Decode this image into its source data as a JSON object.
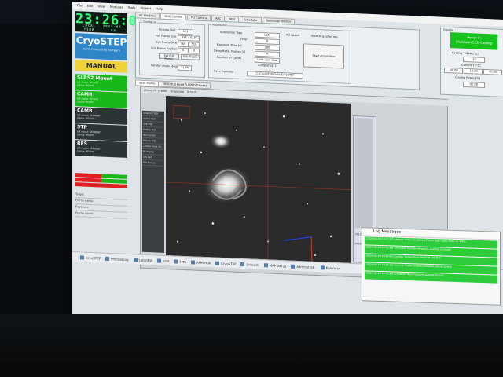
{
  "menubar": [
    "File",
    "Edit",
    "View",
    "Modules",
    "Tools",
    "Project",
    "Help"
  ],
  "clock": {
    "time": "23:26:06",
    "date_left": "LOCAL TIME",
    "date_right": "2024-04-08"
  },
  "logo": {
    "title": "CryoSTEP",
    "subtitle": "AUTO Powered by Software"
  },
  "mode": "MANUAL mode",
  "status_items": [
    {
      "name": "SLRS7 Mount",
      "line1": "set mode: ACTIVE",
      "line2": "status: READY",
      "style": "green"
    },
    {
      "name": "CAMR",
      "line1": "set mode: ACTIVE",
      "line2": "status: READY",
      "style": "green"
    },
    {
      "name": "CAMB",
      "line1": "set mode: STANDBY",
      "line2": "status: READY",
      "style": "dark"
    },
    {
      "name": "STP",
      "line1": "set mode: STANDBY",
      "line2": "status: READY",
      "style": "dark"
    },
    {
      "name": "RFS",
      "line1": "set mode: STANDBY",
      "line2": "status: READY",
      "style": "dark"
    }
  ],
  "mini_rows": [
    "Target",
    "Frame name:",
    "Exposure:",
    "Frame count:"
  ],
  "top_tabs": [
    "All Windows",
    "SBIG Camera",
    "FLI Camera",
    "APC",
    "Mail",
    "Scheduler",
    "Telescope Monitor"
  ],
  "config": {
    "title": "Configure",
    "binning_label": "Binning [px]",
    "binning_value": "1x1",
    "full_frame_label": "Full Frame Size",
    "full_frame_value": "765 x 510",
    "sub_frame_size_label": "Sub Frame Size",
    "sub_frame_w": "765",
    "sub_frame_h": "510",
    "sub_frame_pos_label": "Sub Frame Position",
    "sub_x": "0",
    "sub_y": "0",
    "full_frame_btn": "Set Full Frame",
    "subframe_btn": "Sub Frame",
    "rotator_label": "Rotator angle (deg)",
    "rotator_value": "11.66"
  },
  "acquisition": {
    "title": "Acquisition",
    "type_label": "Acquisition Type",
    "type_value": "Light",
    "filter_label": "Filter",
    "filter_value": "G",
    "exposure_label": "Exposure Time [s]",
    "exposure_value": "180",
    "delay_label": "Delay Betw. Frames [s]",
    "delay_value": "0",
    "cycles_label": "Number of Cycles",
    "cycles_value": "Until user stop",
    "completed": "Completed: 1",
    "save_fits_label": "Save Frame(s)",
    "path_value": "C:\\CryoSTEP\\Data\\CryoSTEP",
    "chk1": "AO speed",
    "chk2": "Start Acq. after rep.",
    "start_btn": "Start Acquisition"
  },
  "cooling": {
    "title": "Cooling",
    "power_btn_line1": "Power in",
    "power_btn_line2": "Shutdown CCD Cooling",
    "goal_label": "Cooling T Goal [°C]",
    "goal_value": "-10",
    "current_label": "Current T [°C]",
    "current_values": [
      "-40.00",
      "-10.20",
      "40.00"
    ],
    "power_label": "Cooling Power [%]",
    "power_value": "65.00"
  },
  "image_tabs": [
    "SBIG Frame",
    "MODBUS Read FLI-PRO Camera"
  ],
  "image_toolbar": [
    "Zoom: Fit Screen",
    "Grayscale",
    "Stretch"
  ],
  "side_panel": [
    "Selected ROI",
    "Action ROI",
    "Sub ROI",
    "Modify ROI",
    "ROI Center",
    "Delete ROI",
    "Center View On",
    "Fit Frame",
    "Sky Ref",
    "Full Frame"
  ],
  "right_col": {
    "label1": "20131.0",
    "label2": "6555.0"
  },
  "status_line": "Position: 440.17, 205.71  Pix. value: 2467.0  Dec: 05h36m00.10s  RA: 09h33m02.21s",
  "taskbar": [
    "CryoSTEP",
    "ProcessLog",
    "LabVIEW",
    "SCH",
    "FITS",
    "AMR Hub",
    "CryoSTEP",
    "Unleash",
    "MAP (MTZ)",
    "Adminstrati.",
    "Kalendar",
    "Kamera",
    "Kommunikace",
    "WebServer",
    "CryoSTEP"
  ],
  "log": {
    "title": "Log Messages",
    "rows": [
      "[2024-04-08 23:21:15] Camera: Exposure started, Frame type: Light, Filter: G, 180 s",
      "[2024-04-08 23:22:40] Telescope: Position refreshed, tracking on target",
      "[2024-04-08 23:24:00] Cooling: Temperature stable at -10.20 C",
      "[2024-04-08 23:24:15] Camera: Frame readout complete, saving to disk",
      "[2024-04-08 23:25:30] Scheduler: Next exposure queued for user"
    ]
  },
  "colors": {
    "green": "#18b81a",
    "clock": "#30ff7a",
    "brand": "#2f86c8",
    "mode": "#f0d23a"
  }
}
